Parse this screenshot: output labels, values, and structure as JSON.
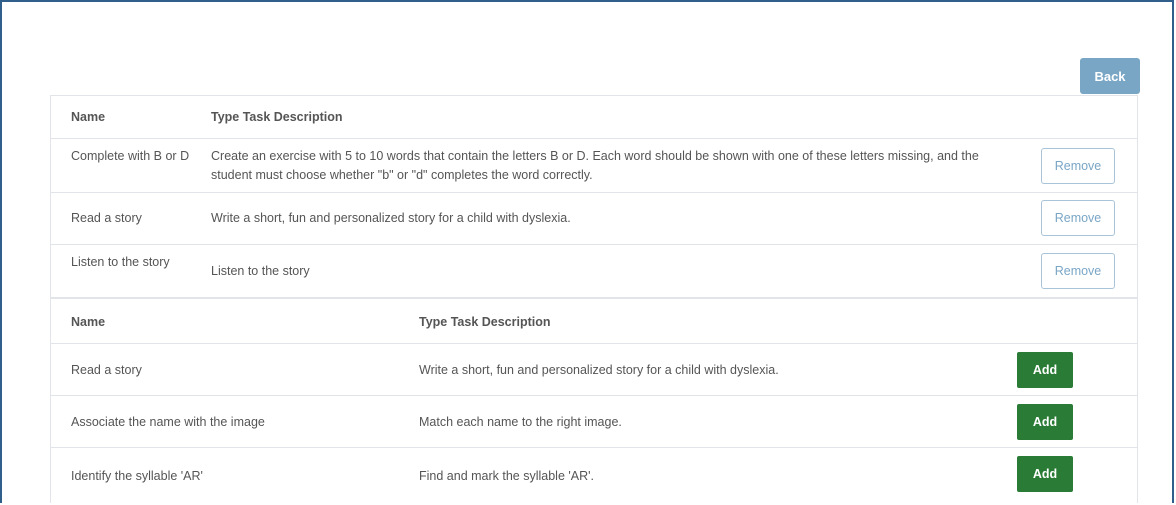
{
  "header": {
    "back_label": "Back"
  },
  "assigned": {
    "columns": {
      "name": "Name",
      "desc": "Type Task Description"
    },
    "rows": [
      {
        "name": "Complete with B or D",
        "desc": "Create an exercise with 5 to 10 words that contain the letters B or D. Each word should be shown with one of these letters missing, and the student must choose whether \"b\" or \"d\" completes the word correctly.",
        "action": "Remove"
      },
      {
        "name": "Read a story",
        "desc": "Write a short, fun and personalized story for a child with dyslexia.",
        "action": "Remove"
      },
      {
        "name": "Listen to the story",
        "desc": "Listen to the story",
        "action": "Remove"
      }
    ]
  },
  "available": {
    "columns": {
      "name": "Name",
      "desc": "Type Task Description"
    },
    "rows": [
      {
        "name": "Read a story",
        "desc": "Write a short, fun and personalized story for a child with dyslexia.",
        "action": "Add"
      },
      {
        "name": "Associate the name with the image",
        "desc": "Match each name to the right image.",
        "action": "Add"
      },
      {
        "name": "Identify the syllable 'AR'",
        "desc": "Find and mark the syllable 'AR'.",
        "action": "Add"
      }
    ]
  },
  "colors": {
    "back": "#7aa6c6",
    "add": "#2a7b36",
    "remove_text": "#7aa6c6",
    "frame": "#2f5f8a"
  }
}
